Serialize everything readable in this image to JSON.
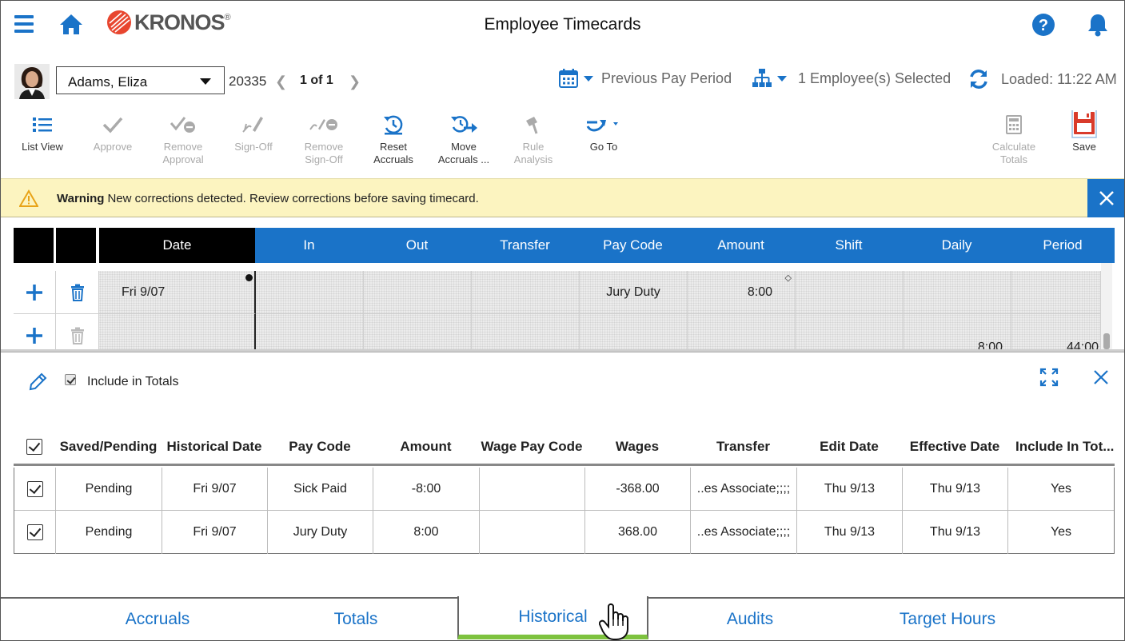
{
  "app": {
    "title": "Employee Timecards",
    "logo_text": "KRONOS",
    "logo_reg": "®"
  },
  "employee": {
    "name": "Adams, Eliza",
    "id": "20335",
    "pager": "1 of 1"
  },
  "header_controls": {
    "pay_period": "Previous Pay Period",
    "selected": "1 Employee(s) Selected",
    "loaded": "Loaded: 11:22 AM"
  },
  "toolbar": {
    "list_view": "List View",
    "approve": "Approve",
    "remove_approval_1": "Remove",
    "remove_approval_2": "Approval",
    "sign_off": "Sign-Off",
    "remove_signoff_1": "Remove",
    "remove_signoff_2": "Sign-Off",
    "reset_accruals_1": "Reset",
    "reset_accruals_2": "Accruals",
    "move_accruals_1": "Move",
    "move_accruals_2": "Accruals ...",
    "rule_analysis_1": "Rule",
    "rule_analysis_2": "Analysis",
    "go_to": "Go To",
    "calculate_totals_1": "Calculate",
    "calculate_totals_2": "Totals",
    "save": "Save"
  },
  "warning": {
    "label": "Warning",
    "message": "New corrections detected. Review corrections before saving timecard."
  },
  "timecard": {
    "columns": {
      "date": "Date",
      "in": "In",
      "out": "Out",
      "transfer": "Transfer",
      "pay_code": "Pay Code",
      "amount": "Amount",
      "shift": "Shift",
      "daily": "Daily",
      "period": "Period"
    },
    "rows": [
      {
        "date": "Fri 9/07",
        "pay_code": "Jury Duty",
        "amount": "8:00",
        "daily": "",
        "period": ""
      },
      {
        "date": "",
        "pay_code": "",
        "amount": "",
        "daily": "8:00",
        "period": "44:00"
      }
    ]
  },
  "historical": {
    "include_in_totals": "Include in Totals",
    "columns": {
      "saved_pending": "Saved/Pending",
      "historical_date": "Historical Date",
      "pay_code": "Pay Code",
      "amount": "Amount",
      "wage_pay_code": "Wage Pay Code",
      "wages": "Wages",
      "transfer": "Transfer",
      "edit_date": "Edit Date",
      "effective_date": "Effective Date",
      "include_in_totals": "Include In Tot..."
    },
    "rows": [
      {
        "status": "Pending",
        "hist_date": "Fri 9/07",
        "pay_code": "Sick Paid",
        "amount": "-8:00",
        "wage_pay_code": "",
        "wages": "-368.00",
        "transfer": "..es Associate;;;;",
        "edit_date": "Thu 9/13",
        "effective_date": "Thu 9/13",
        "include": "Yes"
      },
      {
        "status": "Pending",
        "hist_date": "Fri 9/07",
        "pay_code": "Jury Duty",
        "amount": "8:00",
        "wage_pay_code": "",
        "wages": "368.00",
        "transfer": "..es Associate;;;;",
        "edit_date": "Thu 9/13",
        "effective_date": "Thu 9/13",
        "include": "Yes"
      }
    ]
  },
  "tabs": {
    "accruals": "Accruals",
    "totals": "Totals",
    "historical": "Historical",
    "audits": "Audits",
    "target_hours": "Target Hours"
  },
  "colors": {
    "accent": "#1a73c8",
    "active_tab": "#7dc23e",
    "warning_bg": "#fcf4c0",
    "header_black": "#000000",
    "save_red": "#d93b2b"
  }
}
